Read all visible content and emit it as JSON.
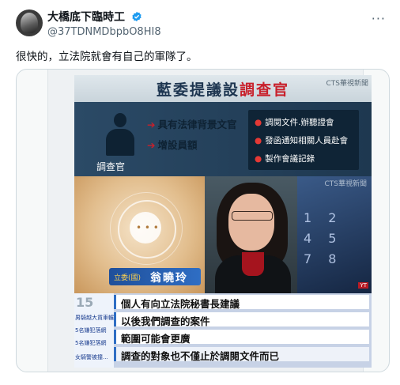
{
  "author": {
    "display_name": "大橋底下臨時工",
    "handle": "@37TDNMDbpbO8HI8",
    "verified": true
  },
  "tweet": {
    "text": "很快的，立法院就會有自己的軍隊了。"
  },
  "menu": {
    "more_label": "···"
  },
  "media": {
    "title_normal": "藍委提議設",
    "title_highlight": "調查官",
    "channel_logo": "CTS華視新聞",
    "watermark": "CTS華視新聞",
    "role_label": "調查官",
    "points": [
      "具有法律背景文官",
      "增設員額"
    ],
    "duties": [
      "調閱文件.辦聽證會",
      "發函通知相關人員赴會",
      "製作會議記錄"
    ],
    "speaker_role": "立委(國)",
    "speaker_name": "翁曉玲",
    "yt_tag": "YT",
    "side_top": "15",
    "side_labels": [
      "男騎越大貨車輾...",
      "5名嫌犯落網",
      "5名嫌犯落網",
      "女騎警被撞..."
    ],
    "captions": [
      "個人有向立法院秘書長建議",
      "以後我們調查的案件",
      "範圍可能會更廣",
      "調查的對象也不僅止於調閱文件而已"
    ]
  },
  "colors": {
    "accent_red": "#c8202b",
    "title_blue": "#1d3550",
    "verified_blue": "#1d9bf0"
  }
}
